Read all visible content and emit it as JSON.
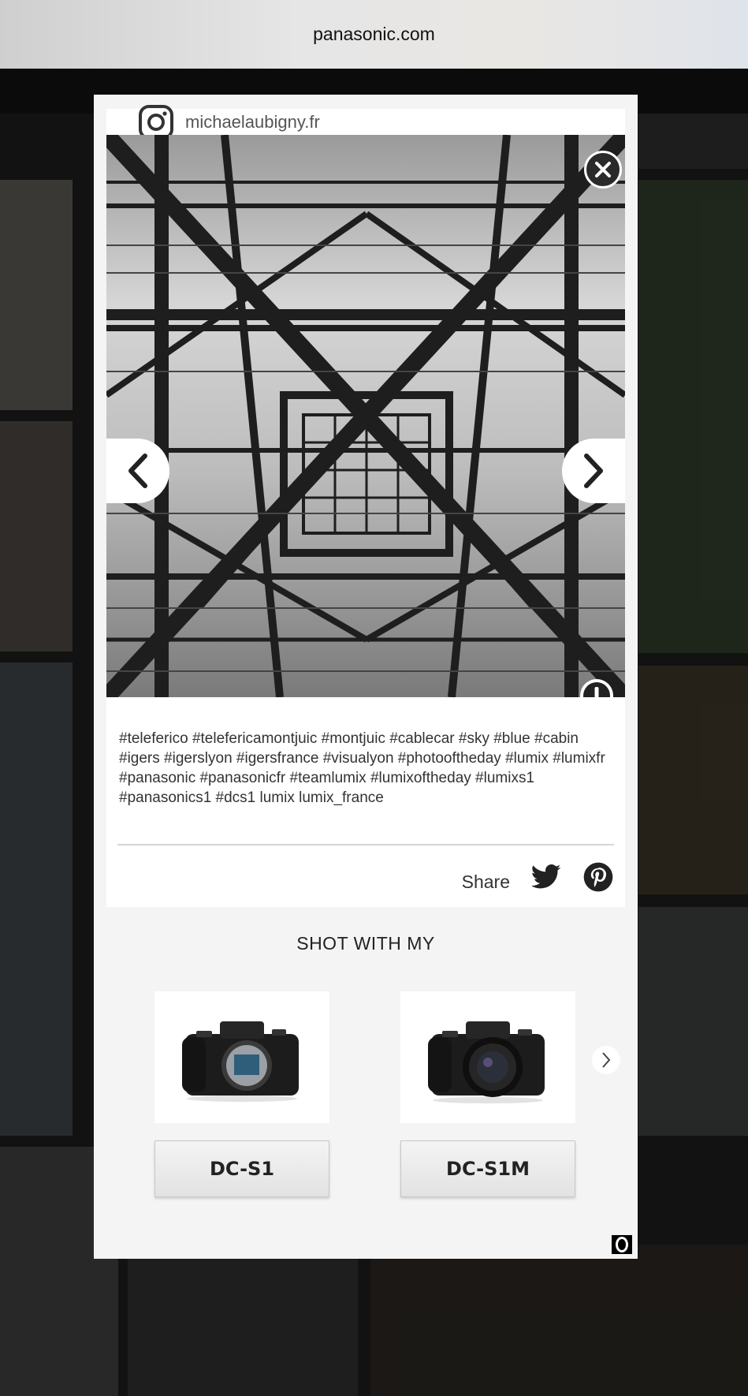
{
  "browser": {
    "url": "panasonic.com"
  },
  "post": {
    "username": "michaelaubigny.fr",
    "caption": "#teleferico #telefericamontjuic #montjuic #cablecar #sky #blue #cabin #igers #igerslyon #igersfrance #visualyon #photooftheday #lumix #lumixfr #panasonic #panasonicfr #teamlumix #lumixoftheday #lumixs1 #panasonics1 #dcs1 lumix lumix_france"
  },
  "share": {
    "label": "Share",
    "icons": [
      "twitter-icon",
      "pinterest-icon"
    ]
  },
  "shot_with": {
    "title": "SHOT WITH MY",
    "products": [
      {
        "name": "DC-S1"
      },
      {
        "name": "DC-S1M"
      }
    ]
  },
  "icons": {
    "close": "close-icon",
    "prev": "chevron-left-icon",
    "next": "chevron-right-icon",
    "report": "exclamation-icon",
    "instagram": "instagram-icon"
  }
}
